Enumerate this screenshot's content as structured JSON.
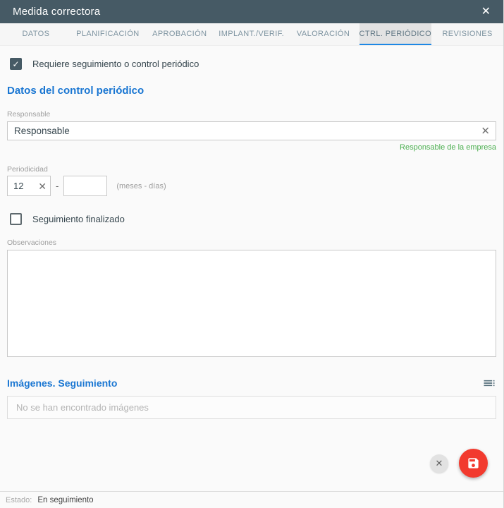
{
  "dialog": {
    "title": "Medida correctora"
  },
  "icons": {
    "close": "✕",
    "clear": "✕",
    "check": "✓",
    "cancel": "✕"
  },
  "tabs": {
    "items": [
      {
        "label": "DATOS",
        "active": false
      },
      {
        "label": "PLANIFICACIÓN",
        "active": false
      },
      {
        "label": "APROBACIÓN",
        "active": false
      },
      {
        "label": "IMPLANT./VERIF.",
        "active": false
      },
      {
        "label": "VALORACIÓN",
        "active": false
      },
      {
        "label": "CTRL. PERIÓDICO",
        "active": true
      },
      {
        "label": "REVISIONES",
        "active": false
      }
    ]
  },
  "form": {
    "requiere": {
      "label": "Requiere seguimiento o control periódico",
      "checked": true
    },
    "section_title": "Datos del control periódico",
    "responsable": {
      "label": "Responsable",
      "value": "Responsable",
      "helper": "Responsable de la empresa"
    },
    "periodicidad": {
      "label": "Periodicidad",
      "meses_value": "12",
      "dias_value": "",
      "separator": "-",
      "hint": "(meses - días)"
    },
    "seguimiento": {
      "label": "Seguimiento finalizado",
      "checked": false
    },
    "observaciones": {
      "label": "Observaciones",
      "value": ""
    },
    "imagenes": {
      "title": "Imágenes. Seguimiento",
      "empty_message": "No se han encontrado imágenes"
    }
  },
  "footer": {
    "estado_label": "Estado:",
    "estado_value": "En seguimiento"
  },
  "colors": {
    "header": "#465a65",
    "accent_blue": "#1976d2",
    "tab_underline": "#1e88e5",
    "helper_green": "#4caf50",
    "save_red": "#f23a2e"
  }
}
